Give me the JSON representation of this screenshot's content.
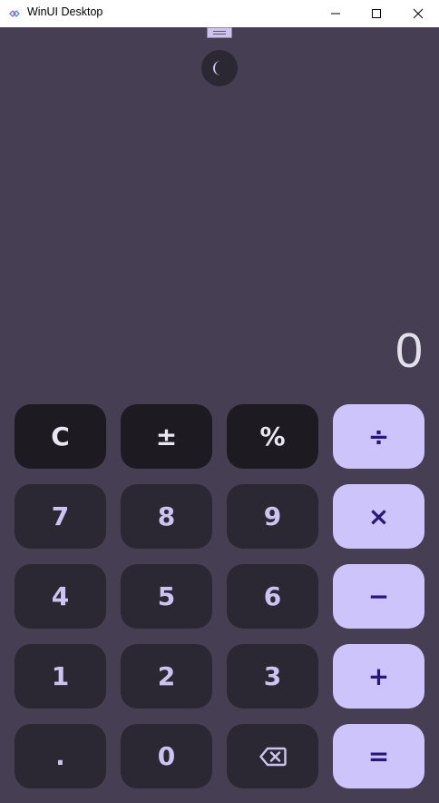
{
  "window": {
    "title": "WinUI Desktop",
    "minimize_glyph": "—",
    "maximize_glyph": "☐",
    "close_glyph": "✕"
  },
  "theme_toggle": {
    "glyph": "☽"
  },
  "display": {
    "value": "0"
  },
  "keys": {
    "clear": "C",
    "sign": "±",
    "percent": "%",
    "divide": "÷",
    "seven": "7",
    "eight": "8",
    "nine": "9",
    "multiply": "×",
    "four": "4",
    "five": "5",
    "six": "6",
    "subtract": "−",
    "one": "1",
    "two": "2",
    "three": "3",
    "add": "+",
    "decimal": ".",
    "zero": "0",
    "equals": "="
  },
  "colors": {
    "background": "#463f54",
    "function_key": "#1d1b21",
    "number_key": "#2c2833",
    "operator_key": "#cec4fc",
    "operator_text": "#2a1679",
    "number_text": "#cec4f2"
  }
}
